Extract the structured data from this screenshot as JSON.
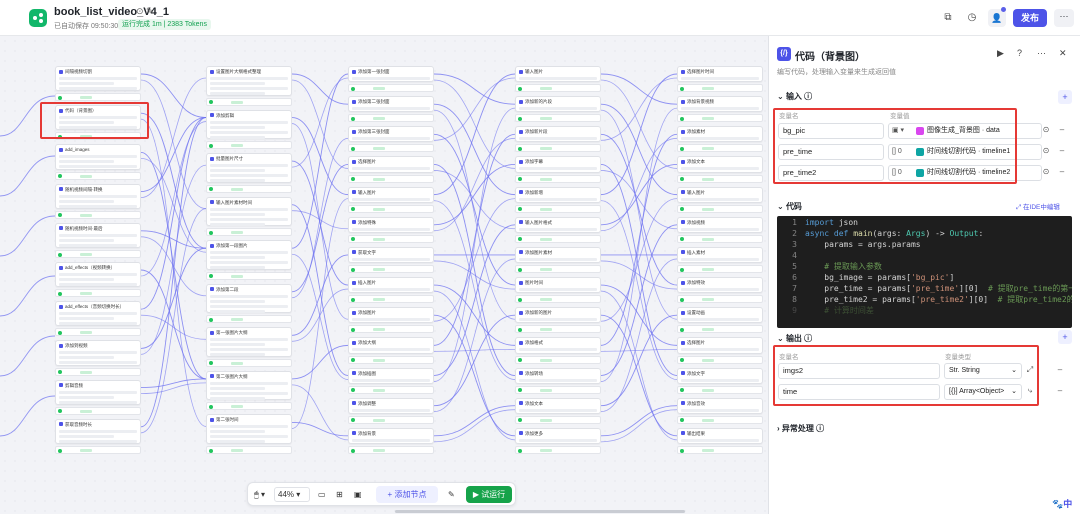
{
  "header": {
    "title": "book_list_video_V4_1",
    "autosave": "已自动保存 09:50:30",
    "run_status": "运行完成 1m | 2383 Tokens",
    "publish": "发布"
  },
  "canvas": {
    "zoom": "44%",
    "add_node": "+ 添加节点",
    "test_run": "▶ 试运行",
    "node_titles": [
      [
        "间隔视频切割",
        "代码（背景图）",
        "add_images",
        "随机视频间隔·转换",
        "随机视频时间·最后",
        "add_effects（视频转换）",
        "add_effects（音频切换时长）",
        "添加到视频",
        "剪辑音频",
        "获取音频时长"
      ],
      [
        "设置图片大纲格式整理",
        "添加剪辑",
        "批量图片尺寸",
        "输入图片素材时间",
        "添加第一段图片",
        "添加第二段",
        "第一张图片大纲",
        "第二张图片大纲",
        "第二张时间"
      ],
      [
        "添加第一张封面",
        "添加第二张封面",
        "添加第三张封面",
        "选择图片",
        "输入图片",
        "添加特殊",
        "获取文字",
        "插入图片",
        "添加图片",
        "添加大纲",
        "添加插图",
        "添加调整",
        "添加背景"
      ],
      [
        "输入图片",
        "添加新的片段",
        "添加新片段",
        "添加字幕",
        "添加新增",
        "输入图片格式",
        "添加图片素材",
        "图片时间",
        "添加新的图片",
        "添加格式",
        "添加转场",
        "添加文本",
        "添加更多"
      ],
      [
        "选择图片时间",
        "添加背景视频",
        "添加素材",
        "添加文本",
        "输入图片",
        "添加视频",
        "插入素材",
        "添加特效",
        "设置动画",
        "选择图片",
        "添加文字",
        "添加音效",
        "输出结果"
      ]
    ]
  },
  "panel": {
    "title": "代码（背景图）",
    "description": "编写代码，处理输入变量来生成返回值",
    "input_section": "输入",
    "col_var_name": "变量名",
    "col_var_value": "变量值",
    "inputs": [
      {
        "name": "bg_pic",
        "type": "图",
        "ref": "图像生成_背景图 · data",
        "tag_color": "#d946ef"
      },
      {
        "name": "pre_time",
        "type": "[] 0",
        "ref": "时间线切割代码 · timeline1",
        "tag_color": "#0ea5a4"
      },
      {
        "name": "pre_time2",
        "type": "[] 0",
        "ref": "时间线切割代码 · timeline2",
        "tag_color": "#0ea5a4"
      }
    ],
    "code_section": "代码",
    "ide_link": "在IDE中编辑",
    "code_lines": [
      {
        "n": "1",
        "text": "import json"
      },
      {
        "n": "2",
        "text": "async def main(args: Args) -> Output:"
      },
      {
        "n": "3",
        "text": "    params = args.params"
      },
      {
        "n": "4",
        "text": ""
      },
      {
        "n": "5",
        "text": "    # 提取输入参数"
      },
      {
        "n": "6",
        "text": "    bg_image = params['bg_pic']"
      },
      {
        "n": "7",
        "text": "    pre_time = params['pre_time'][0]  # 提取pre_time的第一个元"
      },
      {
        "n": "8",
        "text": "    pre_time2 = params['pre_time2'][0]  # 提取pre_time2的第一"
      },
      {
        "n": "9",
        "text": "    # 计算时间差"
      }
    ],
    "output_section": "输出",
    "col_out_type": "变量类型",
    "outputs": [
      {
        "name": "imgs2",
        "type": "Str. String"
      },
      {
        "name": "time",
        "type": "[{}] Array<Object>"
      }
    ],
    "exception_section": "异常处理"
  },
  "colors": {
    "accent": "#4d53e8",
    "success": "#16a34a",
    "highlight": "#e53935"
  }
}
